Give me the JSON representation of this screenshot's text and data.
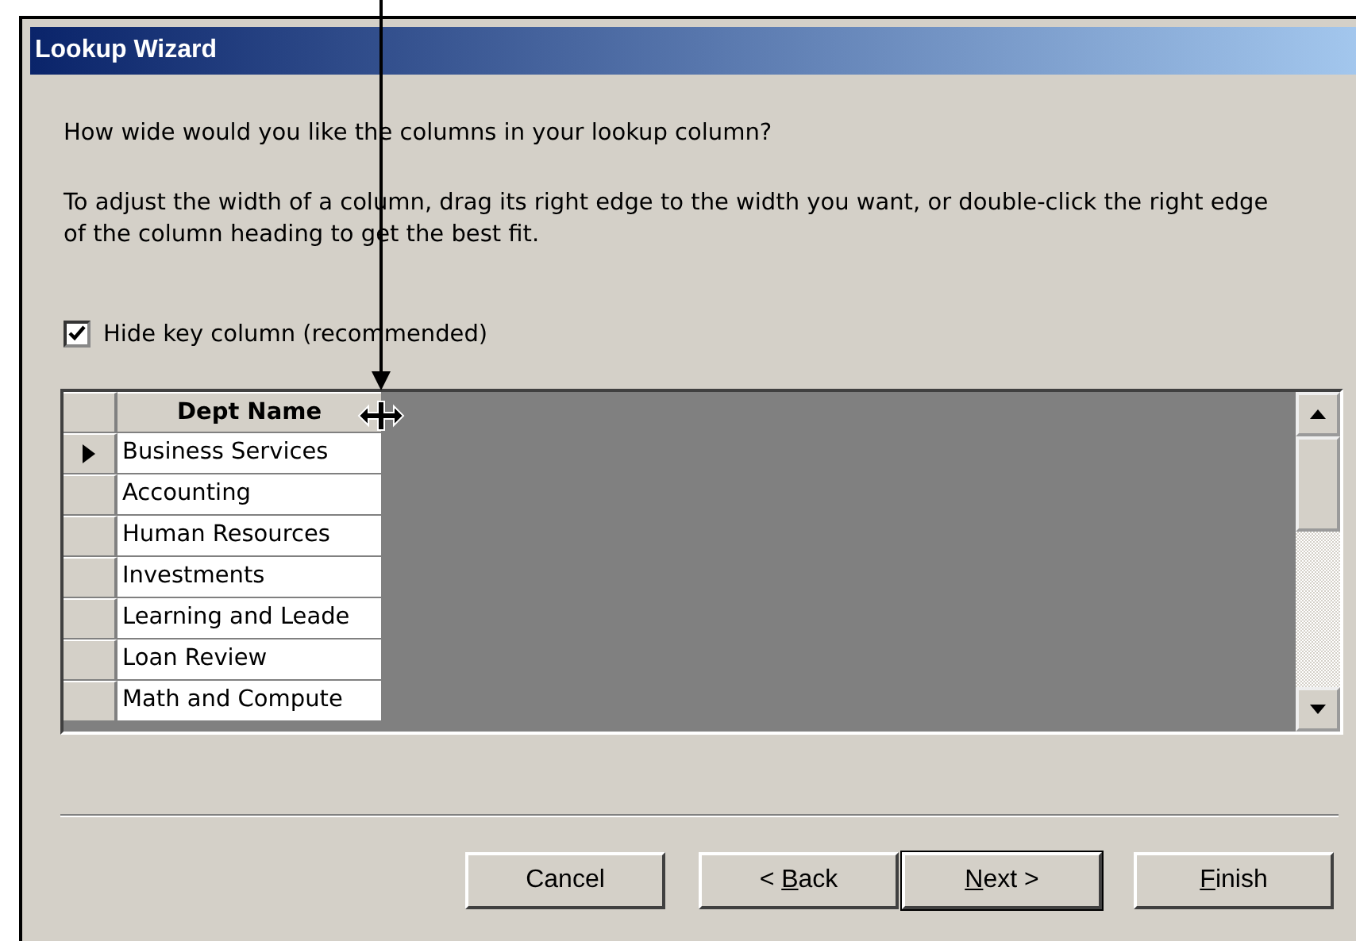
{
  "window": {
    "title": "Lookup Wizard"
  },
  "question": "How wide would you like the columns in your lookup column?",
  "instructions": "To adjust the width of a column, drag its right edge to the width you want, or double-click the right edge of the column heading to get the best fit.",
  "hide_key_column": {
    "label": "Hide key column (recommended)",
    "checked": true
  },
  "grid": {
    "columns": [
      "Dept Name"
    ],
    "rows": [
      {
        "cells": [
          "Business Services"
        ],
        "current": true
      },
      {
        "cells": [
          "Accounting"
        ],
        "current": false
      },
      {
        "cells": [
          "Human Resources"
        ],
        "current": false
      },
      {
        "cells": [
          "Investments"
        ],
        "current": false
      },
      {
        "cells": [
          "Learning and Leade"
        ],
        "current": false
      },
      {
        "cells": [
          "Loan Review"
        ],
        "current": false
      },
      {
        "cells": [
          "Math and Compute"
        ],
        "current": false
      }
    ]
  },
  "buttons": [
    {
      "label_before": "Cancel",
      "default": false
    },
    {
      "label_before": "< ",
      "access_key": "B",
      "label_after": "ack",
      "default": false
    },
    {
      "access_key": "N",
      "label_after": "ext >",
      "default": true
    },
    {
      "access_key": "F",
      "label_after": "inish",
      "default": false
    }
  ]
}
